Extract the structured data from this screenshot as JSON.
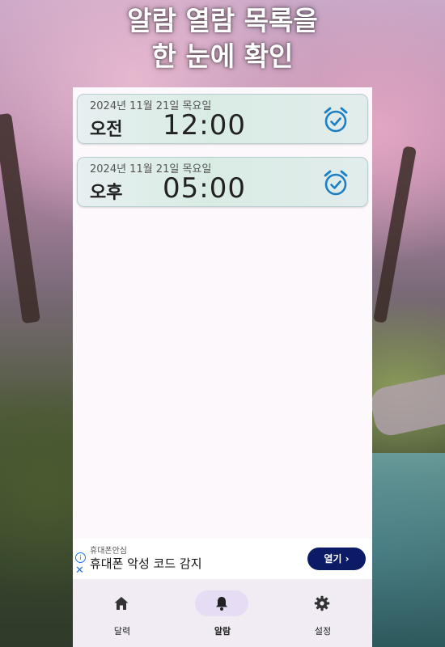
{
  "headline": {
    "line1": "알람 열람 목록을",
    "line2": "한 눈에 확인"
  },
  "alarms": [
    {
      "date": "2024년 11월 21일 목요일",
      "ampm": "오전",
      "time": "12:00",
      "icon": "alarm-check-icon"
    },
    {
      "date": "2024년 11월 21일 목요일",
      "ampm": "오후",
      "time": "05:00",
      "icon": "alarm-check-icon"
    }
  ],
  "ad": {
    "source": "휴대폰안심",
    "title": "휴대폰 악성 코드 감지",
    "button": "열기 ›"
  },
  "nav": {
    "items": [
      {
        "label": "달력",
        "icon": "home-icon",
        "active": false
      },
      {
        "label": "알람",
        "icon": "bell-icon",
        "active": true
      },
      {
        "label": "설정",
        "icon": "gear-icon",
        "active": false
      }
    ]
  },
  "colors": {
    "accent": "#1a7fc4",
    "ad_button": "#0c1b66",
    "nav_active_pill": "#e6ddf4"
  }
}
